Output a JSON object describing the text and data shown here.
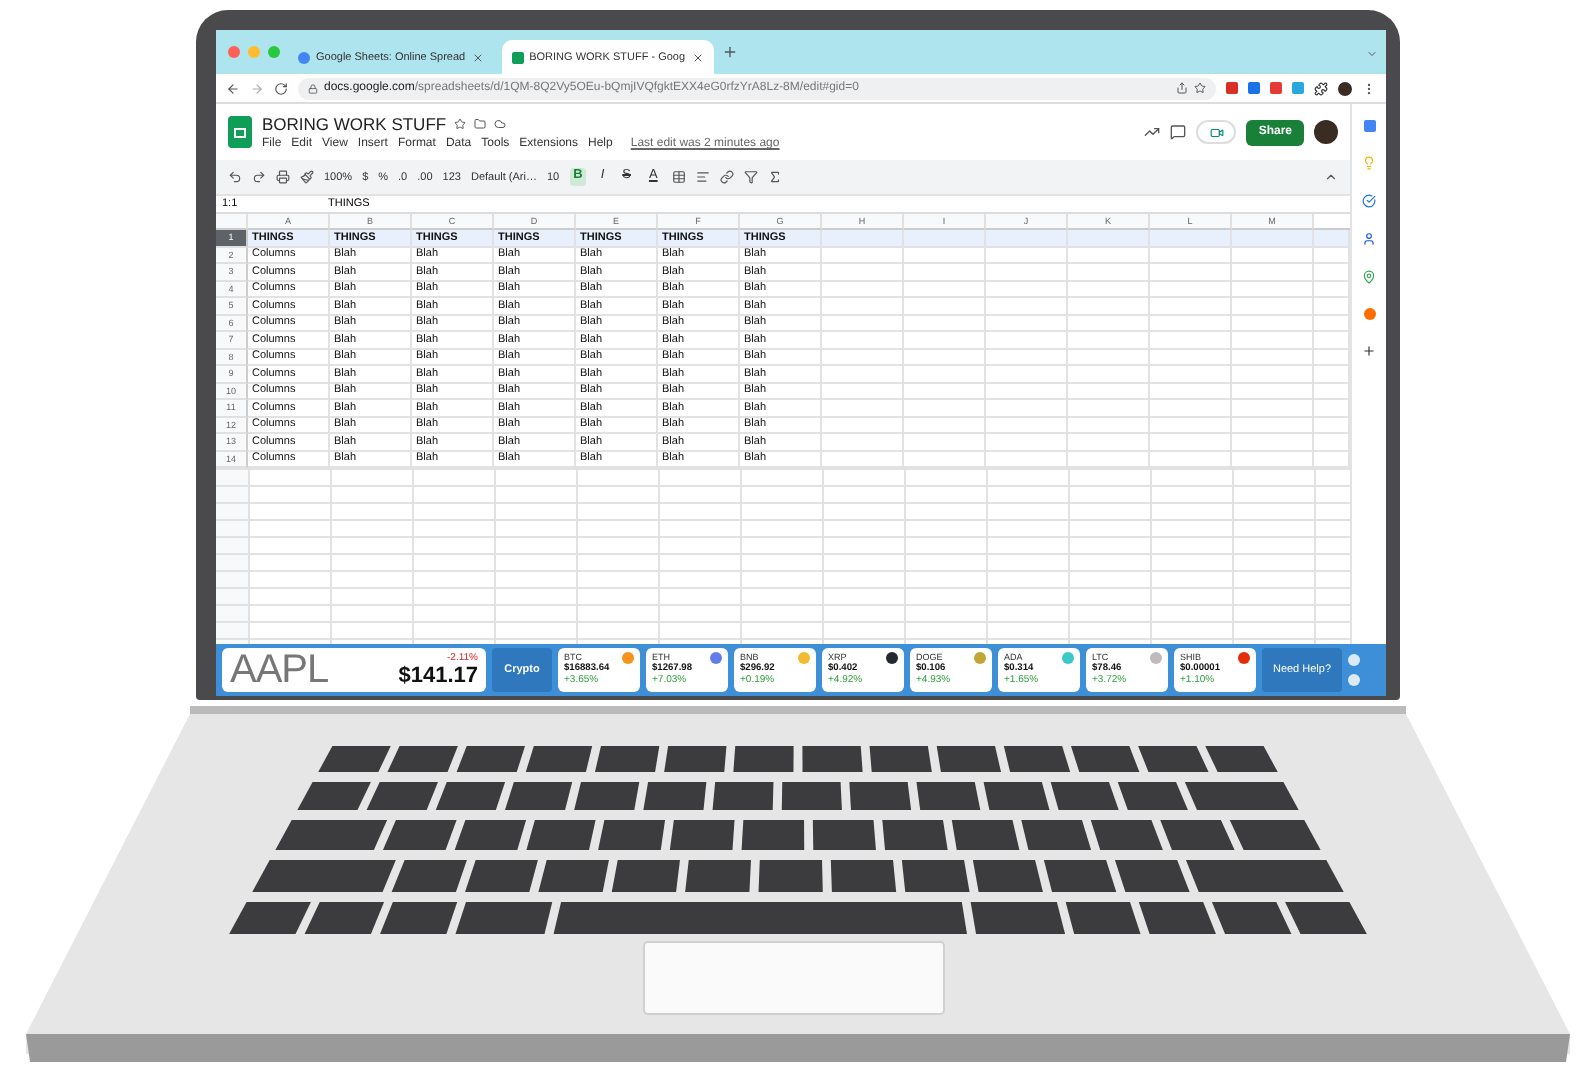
{
  "browser": {
    "tabs": [
      {
        "title": "Google Sheets: Online Spread",
        "selected": false
      },
      {
        "title": "BORING WORK STUFF - Goog",
        "selected": true
      }
    ],
    "url_host": "docs.google.com",
    "url_path": "/spreadsheets/d/1QM-8Q2Vy5OEu-bQmjIVQfgktEXX4eG0rfzYrA8Lz-8M/edit#gid=0"
  },
  "doc": {
    "title": "BORING WORK STUFF",
    "menus": [
      "File",
      "Edit",
      "View",
      "Insert",
      "Format",
      "Data",
      "Tools",
      "Extensions",
      "Help"
    ],
    "last_edit": "Last edit was 2 minutes ago",
    "share": "Share"
  },
  "toolbar": {
    "zoom": "100%",
    "number_formats": [
      "$",
      "%",
      ".0",
      ".00"
    ],
    "format_menu": "123",
    "font": "Default (Ari…",
    "font_size": "10",
    "styles": [
      {
        "label": "B",
        "active": true
      },
      {
        "label": "I",
        "active": false
      },
      {
        "label": "S",
        "active": false
      },
      {
        "label": "A",
        "active": false
      }
    ]
  },
  "formula_bar": {
    "cell": "1:1",
    "value": "THINGS"
  },
  "sheet": {
    "columns": [
      "A",
      "B",
      "C",
      "D",
      "E",
      "F",
      "G",
      "H",
      "I",
      "J",
      "K",
      "L",
      "M"
    ],
    "rows": [
      {
        "number": "1",
        "kind": "header",
        "selected": true,
        "cells": [
          "THINGS",
          "THINGS",
          "THINGS",
          "THINGS",
          "THINGS",
          "THINGS",
          "THINGS"
        ]
      },
      {
        "number": "2",
        "kind": "data",
        "selected": false,
        "cells": [
          "Columns",
          "Blah",
          "Blah",
          "Blah",
          "Blah",
          "Blah",
          "Blah"
        ]
      },
      {
        "number": "3",
        "kind": "data",
        "selected": false,
        "cells": [
          "Columns",
          "Blah",
          "Blah",
          "Blah",
          "Blah",
          "Blah",
          "Blah"
        ]
      },
      {
        "number": "4",
        "kind": "data",
        "selected": false,
        "cells": [
          "Columns",
          "Blah",
          "Blah",
          "Blah",
          "Blah",
          "Blah",
          "Blah"
        ]
      },
      {
        "number": "5",
        "kind": "data",
        "selected": false,
        "cells": [
          "Columns",
          "Blah",
          "Blah",
          "Blah",
          "Blah",
          "Blah",
          "Blah"
        ]
      },
      {
        "number": "6",
        "kind": "data",
        "selected": false,
        "cells": [
          "Columns",
          "Blah",
          "Blah",
          "Blah",
          "Blah",
          "Blah",
          "Blah"
        ]
      },
      {
        "number": "7",
        "kind": "data",
        "selected": false,
        "cells": [
          "Columns",
          "Blah",
          "Blah",
          "Blah",
          "Blah",
          "Blah",
          "Blah"
        ]
      },
      {
        "number": "8",
        "kind": "data",
        "selected": false,
        "cells": [
          "Columns",
          "Blah",
          "Blah",
          "Blah",
          "Blah",
          "Blah",
          "Blah"
        ]
      },
      {
        "number": "9",
        "kind": "data",
        "selected": false,
        "cells": [
          "Columns",
          "Blah",
          "Blah",
          "Blah",
          "Blah",
          "Blah",
          "Blah"
        ]
      },
      {
        "number": "10",
        "kind": "data",
        "selected": false,
        "cells": [
          "Columns",
          "Blah",
          "Blah",
          "Blah",
          "Blah",
          "Blah",
          "Blah"
        ]
      },
      {
        "number": "11",
        "kind": "data",
        "selected": false,
        "cells": [
          "Columns",
          "Blah",
          "Blah",
          "Blah",
          "Blah",
          "Blah",
          "Blah"
        ]
      },
      {
        "number": "12",
        "kind": "data",
        "selected": false,
        "cells": [
          "Columns",
          "Blah",
          "Blah",
          "Blah",
          "Blah",
          "Blah",
          "Blah"
        ]
      },
      {
        "number": "13",
        "kind": "data",
        "selected": false,
        "cells": [
          "Columns",
          "Blah",
          "Blah",
          "Blah",
          "Blah",
          "Blah",
          "Blah"
        ]
      },
      {
        "number": "14",
        "kind": "data",
        "selected": false,
        "cells": [
          "Columns",
          "Blah",
          "Blah",
          "Blah",
          "Blah",
          "Blah",
          "Blah"
        ]
      }
    ]
  },
  "ticker": {
    "symbol": "AAPL",
    "change": "-2.11%",
    "price": "$141.17",
    "tab": "Crypto",
    "help": "Need Help?",
    "coins": [
      {
        "name": "BTC",
        "price": "$16883.64",
        "change": "+3.65%",
        "color": "#f7931a"
      },
      {
        "name": "ETH",
        "price": "$1267.98",
        "change": "+7.03%",
        "color": "#627eea"
      },
      {
        "name": "BNB",
        "price": "$296.92",
        "change": "+0.19%",
        "color": "#f3ba2f"
      },
      {
        "name": "XRP",
        "price": "$0.402",
        "change": "+4.92%",
        "color": "#23292f"
      },
      {
        "name": "DOGE",
        "price": "$0.106",
        "change": "+4.93%",
        "color": "#c2a633"
      },
      {
        "name": "ADA",
        "price": "$0.314",
        "change": "+1.65%",
        "color": "#3cc8c8"
      },
      {
        "name": "LTC",
        "price": "$78.46",
        "change": "+3.72%",
        "color": "#bfbbbb"
      },
      {
        "name": "SHIB",
        "price": "$0.00001",
        "change": "+1.10%",
        "color": "#e42d04"
      }
    ]
  }
}
